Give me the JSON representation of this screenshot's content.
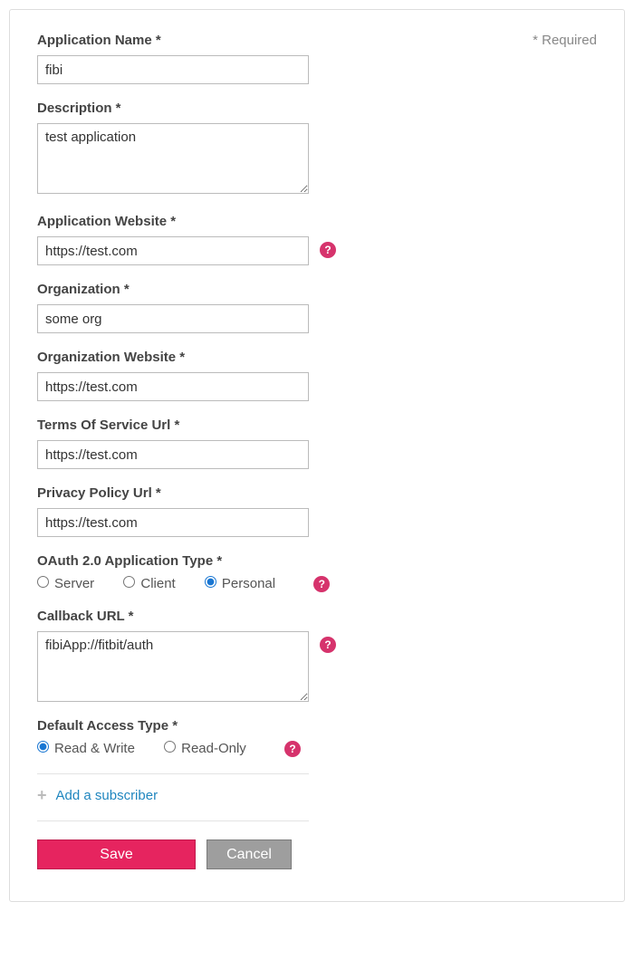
{
  "required_note": "* Required",
  "fields": {
    "app_name": {
      "label": "Application Name *",
      "value": "fibi"
    },
    "description": {
      "label": "Description *",
      "value": "test application"
    },
    "app_website": {
      "label": "Application Website *",
      "value": "https://test.com"
    },
    "organization": {
      "label": "Organization *",
      "value": "some org"
    },
    "org_website": {
      "label": "Organization Website *",
      "value": "https://test.com"
    },
    "tos_url": {
      "label": "Terms Of Service Url *",
      "value": "https://test.com"
    },
    "privacy_url": {
      "label": "Privacy Policy Url *",
      "value": "https://test.com"
    },
    "oauth_type": {
      "label": "OAuth 2.0 Application Type *",
      "options": {
        "server": "Server",
        "client": "Client",
        "personal": "Personal"
      },
      "selected": "personal"
    },
    "callback_url": {
      "label": "Callback URL *",
      "value": "fibiApp://fitbit/auth"
    },
    "access_type": {
      "label": "Default Access Type *",
      "options": {
        "rw": "Read & Write",
        "ro": "Read-Only"
      },
      "selected": "rw"
    }
  },
  "add_subscriber": "Add a subscriber",
  "buttons": {
    "save": "Save",
    "cancel": "Cancel"
  }
}
